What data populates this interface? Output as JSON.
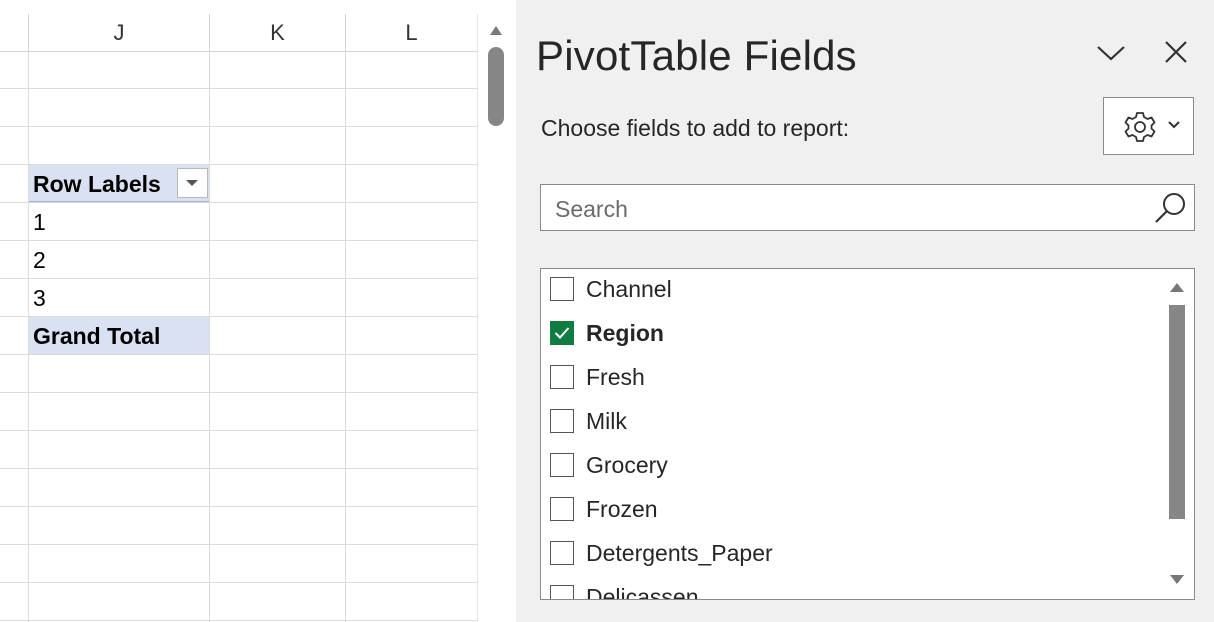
{
  "sheet": {
    "columns": [
      "J",
      "K",
      "L"
    ],
    "pivot": {
      "header": "Row Labels",
      "rows": [
        "1",
        "2",
        "3"
      ],
      "total": "Grand Total"
    }
  },
  "pane": {
    "title": "PivotTable Fields",
    "choose_label": "Choose fields to add to report:",
    "search": {
      "placeholder": "Search",
      "value": ""
    },
    "fields": [
      {
        "label": "Channel",
        "checked": false
      },
      {
        "label": "Region",
        "checked": true
      },
      {
        "label": "Fresh",
        "checked": false
      },
      {
        "label": "Milk",
        "checked": false
      },
      {
        "label": "Grocery",
        "checked": false
      },
      {
        "label": "Frozen",
        "checked": false
      },
      {
        "label": "Detergents_Paper",
        "checked": false
      },
      {
        "label": "Delicassen",
        "checked": false
      }
    ],
    "checked_color": "#107c41",
    "pivot_fill_color": "#d9e1f2"
  }
}
